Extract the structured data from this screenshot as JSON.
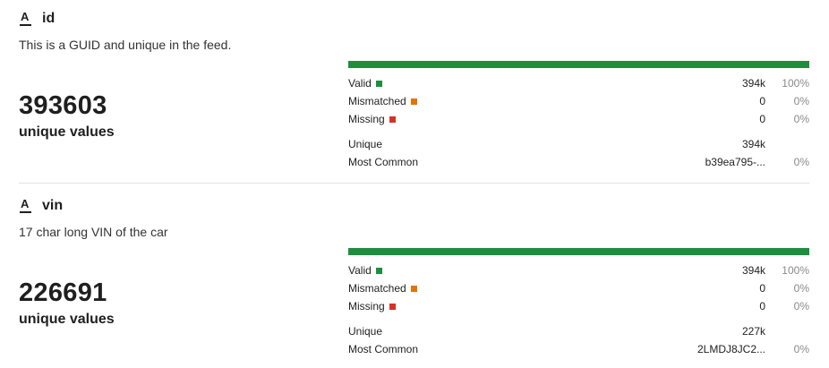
{
  "colors": {
    "valid": "#1e8e3e",
    "mismatched": "#e37400",
    "missing": "#d93025"
  },
  "columns": [
    {
      "type_icon": "string-type-icon",
      "type_glyph": "A",
      "name": "id",
      "description": "This is a GUID and unique in the feed.",
      "unique_count": "393603",
      "unique_label": "unique values",
      "valid_fraction": 1.0,
      "stats": {
        "valid": {
          "label": "Valid",
          "value": "394k",
          "pct": "100%"
        },
        "mismatched": {
          "label": "Mismatched",
          "value": "0",
          "pct": "0%"
        },
        "missing": {
          "label": "Missing",
          "value": "0",
          "pct": "0%"
        },
        "unique": {
          "label": "Unique",
          "value": "394k"
        },
        "most_common": {
          "label": "Most Common",
          "value": "b39ea795-...",
          "pct": "0%"
        }
      }
    },
    {
      "type_icon": "string-type-icon",
      "type_glyph": "A",
      "name": "vin",
      "description": "17 char long VIN of the car",
      "unique_count": "226691",
      "unique_label": "unique values",
      "valid_fraction": 1.0,
      "stats": {
        "valid": {
          "label": "Valid",
          "value": "394k",
          "pct": "100%"
        },
        "mismatched": {
          "label": "Mismatched",
          "value": "0",
          "pct": "0%"
        },
        "missing": {
          "label": "Missing",
          "value": "0",
          "pct": "0%"
        },
        "unique": {
          "label": "Unique",
          "value": "227k"
        },
        "most_common": {
          "label": "Most Common",
          "value": "2LMDJ8JC2...",
          "pct": "0%"
        }
      }
    }
  ]
}
